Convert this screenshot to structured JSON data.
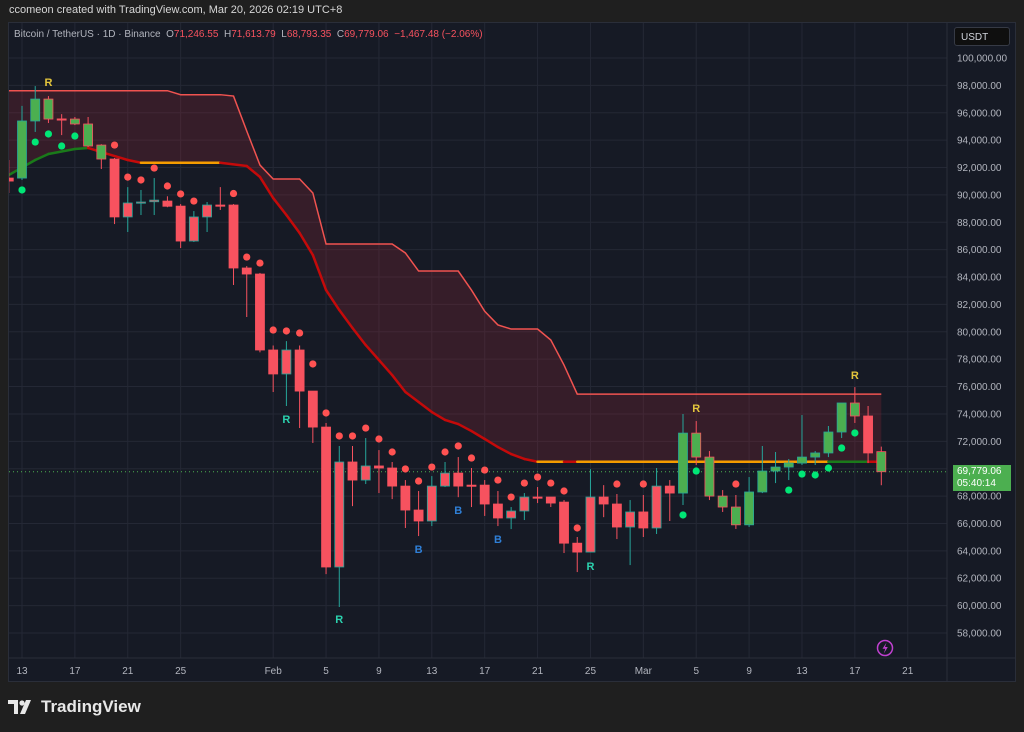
{
  "credit": "ccomeon created with TradingView.com, Mar 20, 2026 02:19 UTC+8",
  "legend": {
    "symbol": "Bitcoin / TetherUS · 1D · Binance",
    "open_label": "O",
    "open": "71,246.55",
    "high_label": "H",
    "high": "71,613.79",
    "low_label": "L",
    "low": "68,793.35",
    "close_label": "C",
    "close": "69,779.06",
    "change": "−1,467.48 (−2.06%)"
  },
  "currency_button": "USDT",
  "last_price": {
    "value": 69779.06,
    "label": "69,779.06",
    "countdown": "05:40:14"
  },
  "brand": "TradingView",
  "icons": {
    "alert": "lightning-icon",
    "logo": "tradingview-logo-icon"
  },
  "colors": {
    "background": "#161a25",
    "grid": "#242835",
    "up_border": "#26a69a",
    "down_border": "#f7525f",
    "fill_green": "#4caf50",
    "fill_red": "#f7525f",
    "dot_green": "#00e676",
    "dot_red": "#ff5252",
    "band": "#f05350",
    "mid_red": "#c40a0a",
    "mid_orange": "#f59c00",
    "mid_green": "#1a7a1a",
    "label_yellow": "#e3c53c",
    "label_teal": "#2bd1ae",
    "label_blue": "#2f7fd6"
  },
  "chart_data": {
    "type": "candlestick",
    "interval": "1D",
    "ylim": [
      56500,
      101500
    ],
    "y_ticks": [
      100000,
      98000,
      96000,
      94000,
      92000,
      90000,
      88000,
      86000,
      84000,
      82000,
      80000,
      78000,
      76000,
      74000,
      72000,
      70000,
      68000,
      66000,
      64000,
      62000,
      60000,
      58000
    ],
    "y_tick_labels": [
      "100,000.00",
      "98,000.00",
      "96,000.00",
      "94,000.00",
      "92,000.00",
      "90,000.00",
      "88,000.00",
      "86,000.00",
      "84,000.00",
      "82,000.00",
      "80,000.00",
      "78,000.00",
      "76,000.00",
      "74,000.00",
      "72,000.00",
      "70,000.00",
      "68,000.00",
      "66,000.00",
      "64,000.00",
      "62,000.00",
      "60,000.00",
      "58,000.00"
    ],
    "x_ticks": [
      {
        "date": "2026-01-13",
        "label": "13"
      },
      {
        "date": "2026-01-17",
        "label": "17"
      },
      {
        "date": "2026-01-21",
        "label": "21"
      },
      {
        "date": "2026-01-25",
        "label": "25"
      },
      {
        "date": "2026-02-01",
        "label": "Feb"
      },
      {
        "date": "2026-02-05",
        "label": "5"
      },
      {
        "date": "2026-02-09",
        "label": "9"
      },
      {
        "date": "2026-02-13",
        "label": "13"
      },
      {
        "date": "2026-02-17",
        "label": "17"
      },
      {
        "date": "2026-02-21",
        "label": "21"
      },
      {
        "date": "2026-02-25",
        "label": "25"
      },
      {
        "date": "2026-03-01",
        "label": "Mar"
      },
      {
        "date": "2026-03-05",
        "label": "5"
      },
      {
        "date": "2026-03-09",
        "label": "9"
      },
      {
        "date": "2026-03-13",
        "label": "13"
      },
      {
        "date": "2026-03-17",
        "label": "17"
      },
      {
        "date": "2026-03-21",
        "label": "21"
      }
    ],
    "candles": [
      [
        "2026-01-12",
        91230,
        92550,
        90140,
        91010,
        "r"
      ],
      [
        "2026-01-13",
        91230,
        96500,
        91090,
        95400,
        "g"
      ],
      [
        "2026-01-14",
        95400,
        97950,
        94600,
        97000,
        "g"
      ],
      [
        "2026-01-15",
        97000,
        97220,
        95250,
        95540,
        "g"
      ],
      [
        "2026-01-16",
        95550,
        95900,
        94370,
        95500,
        "r"
      ],
      [
        "2026-01-17",
        95540,
        95690,
        95100,
        95180,
        "g"
      ],
      [
        "2026-01-18",
        95180,
        95690,
        93500,
        93570,
        "g"
      ],
      [
        "2026-01-19",
        93640,
        93700,
        91890,
        92620,
        "g"
      ],
      [
        "2026-01-20",
        92620,
        92700,
        87870,
        88390,
        "r"
      ],
      [
        "2026-01-21",
        88390,
        90570,
        87290,
        89410,
        "r"
      ],
      [
        "2026-01-22",
        89400,
        90360,
        88530,
        89480,
        "r"
      ],
      [
        "2026-01-23",
        89500,
        91230,
        88530,
        89620,
        "r"
      ],
      [
        "2026-01-24",
        89550,
        89900,
        89100,
        89170,
        "r"
      ],
      [
        "2026-01-25",
        89180,
        89330,
        86120,
        86630,
        "r"
      ],
      [
        "2026-01-26",
        86630,
        88820,
        86560,
        88390,
        "r"
      ],
      [
        "2026-01-27",
        88390,
        89480,
        87290,
        89260,
        "r"
      ],
      [
        "2026-01-28",
        89260,
        90570,
        88900,
        89200,
        "r"
      ],
      [
        "2026-01-29",
        89260,
        89330,
        83420,
        84660,
        "r"
      ],
      [
        "2026-01-30",
        84660,
        84800,
        81080,
        84220,
        "r"
      ],
      [
        "2026-01-31",
        84220,
        84300,
        78500,
        78670,
        "r"
      ],
      [
        "2026-02-01",
        78670,
        79000,
        75600,
        76920,
        "r"
      ],
      [
        "2026-02-02",
        76920,
        79320,
        74580,
        78670,
        "r"
      ],
      [
        "2026-02-03",
        78670,
        79000,
        72970,
        75670,
        "r"
      ],
      [
        "2026-02-04",
        75670,
        75670,
        71880,
        73040,
        "r"
      ],
      [
        "2026-02-05",
        73040,
        73340,
        62300,
        62820,
        "r"
      ],
      [
        "2026-02-06",
        62820,
        71660,
        59900,
        70490,
        "r"
      ],
      [
        "2026-02-07",
        70490,
        71660,
        67270,
        69170,
        "r"
      ],
      [
        "2026-02-08",
        69170,
        72240,
        68880,
        70200,
        "r"
      ],
      [
        "2026-02-09",
        70200,
        71360,
        68220,
        70050,
        "r"
      ],
      [
        "2026-02-10",
        70050,
        70490,
        67780,
        68730,
        "r"
      ],
      [
        "2026-02-11",
        68730,
        69170,
        65670,
        66980,
        "r"
      ],
      [
        "2026-02-12",
        66980,
        68370,
        65080,
        66180,
        "r"
      ],
      [
        "2026-02-13",
        66180,
        69460,
        65810,
        68730,
        "r"
      ],
      [
        "2026-02-14",
        68730,
        70490,
        68660,
        69680,
        "r"
      ],
      [
        "2026-02-15",
        69680,
        70850,
        67920,
        68730,
        "r"
      ],
      [
        "2026-02-16",
        68800,
        70050,
        67200,
        68790,
        "r"
      ],
      [
        "2026-02-17",
        68800,
        69170,
        66550,
        67420,
        "r"
      ],
      [
        "2026-02-18",
        67420,
        68370,
        65810,
        66400,
        "r"
      ],
      [
        "2026-02-19",
        66400,
        67200,
        65590,
        66910,
        "r"
      ],
      [
        "2026-02-20",
        66910,
        68220,
        66250,
        67930,
        "r"
      ],
      [
        "2026-02-21",
        67930,
        68660,
        67490,
        67900,
        "r"
      ],
      [
        "2026-02-22",
        67930,
        67930,
        67200,
        67490,
        "r"
      ],
      [
        "2026-02-23",
        67560,
        67710,
        63840,
        64560,
        "r"
      ],
      [
        "2026-02-24",
        64560,
        65010,
        62450,
        63910,
        "r"
      ],
      [
        "2026-02-25",
        63910,
        69970,
        63910,
        67930,
        "r"
      ],
      [
        "2026-02-26",
        67930,
        68800,
        66460,
        67420,
        "r"
      ],
      [
        "2026-02-27",
        67420,
        68150,
        64860,
        65740,
        "r"
      ],
      [
        "2026-02-28",
        65740,
        67710,
        62960,
        66840,
        "r"
      ],
      [
        "2026-03-01",
        66840,
        68080,
        65010,
        65670,
        "r"
      ],
      [
        "2026-03-02",
        65670,
        70050,
        65230,
        68730,
        "r"
      ],
      [
        "2026-03-03",
        68730,
        69170,
        66180,
        68220,
        "r"
      ],
      [
        "2026-03-04",
        68220,
        74000,
        67350,
        72600,
        "g"
      ],
      [
        "2026-03-05",
        72600,
        73480,
        70270,
        70850,
        "g"
      ],
      [
        "2026-03-06",
        70850,
        71290,
        67710,
        68000,
        "g"
      ],
      [
        "2026-03-07",
        68000,
        68440,
        66840,
        67200,
        "g"
      ],
      [
        "2026-03-08",
        67200,
        68080,
        65600,
        65900,
        "g"
      ],
      [
        "2026-03-09",
        65900,
        69390,
        65740,
        68300,
        "g"
      ],
      [
        "2026-03-10",
        68300,
        71660,
        68220,
        69830,
        "g"
      ],
      [
        "2026-03-11",
        69830,
        71220,
        68950,
        70120,
        "g"
      ],
      [
        "2026-03-12",
        70120,
        70710,
        69170,
        70410,
        "g"
      ],
      [
        "2026-03-13",
        70410,
        73920,
        70270,
        70850,
        "g"
      ],
      [
        "2026-03-14",
        70850,
        71290,
        70270,
        71150,
        "g"
      ],
      [
        "2026-03-15",
        71150,
        73120,
        70850,
        72680,
        "g"
      ],
      [
        "2026-03-16",
        72680,
        74800,
        72240,
        74800,
        "g"
      ],
      [
        "2026-03-17",
        74800,
        75960,
        73340,
        73850,
        "g"
      ],
      [
        "2026-03-18",
        73850,
        74580,
        70410,
        71150,
        "r"
      ],
      [
        "2026-03-19",
        71246.55,
        71613.79,
        68793.35,
        69779.06,
        "g"
      ]
    ],
    "upper_band": [
      [
        "2026-01-12",
        97610
      ],
      [
        "2026-01-24",
        97610
      ],
      [
        "2026-01-25",
        97320
      ],
      [
        "2026-01-28",
        97320
      ],
      [
        "2026-01-29",
        97220
      ],
      [
        "2026-01-30",
        94670
      ],
      [
        "2026-01-31",
        92180
      ],
      [
        "2026-02-01",
        91160
      ],
      [
        "2026-02-03",
        91160
      ],
      [
        "2026-02-04",
        90140
      ],
      [
        "2026-02-05",
        86410
      ],
      [
        "2026-02-10",
        86410
      ],
      [
        "2026-02-11",
        85760
      ],
      [
        "2026-02-12",
        84440
      ],
      [
        "2026-02-15",
        84440
      ],
      [
        "2026-02-16",
        83050
      ],
      [
        "2026-02-17",
        81500
      ],
      [
        "2026-02-18",
        80500
      ],
      [
        "2026-02-19",
        80200
      ],
      [
        "2026-02-21",
        80200
      ],
      [
        "2026-02-22",
        79400
      ],
      [
        "2026-02-23",
        77570
      ],
      [
        "2026-02-24",
        75450
      ],
      [
        "2026-03-19",
        75450
      ]
    ],
    "middle_line": [
      [
        "2026-01-12",
        91450,
        "green"
      ],
      [
        "2026-01-14",
        92550,
        "green"
      ],
      [
        "2026-01-15",
        92990,
        "green"
      ],
      [
        "2026-01-17",
        93350,
        "green"
      ],
      [
        "2026-01-18",
        93430,
        "red"
      ],
      [
        "2026-01-19",
        93130,
        "red"
      ],
      [
        "2026-01-21",
        92550,
        "red"
      ],
      [
        "2026-01-22",
        92350,
        "orange"
      ],
      [
        "2026-01-28",
        92350,
        "red"
      ],
      [
        "2026-01-30",
        92110,
        "red"
      ],
      [
        "2026-01-31",
        91310,
        "red"
      ],
      [
        "2026-02-01",
        89770,
        "red"
      ],
      [
        "2026-02-02",
        88530,
        "red"
      ],
      [
        "2026-02-03",
        87220,
        "red"
      ],
      [
        "2026-02-04",
        85610,
        "red"
      ],
      [
        "2026-02-05",
        83050,
        "red"
      ],
      [
        "2026-02-06",
        81590,
        "red"
      ],
      [
        "2026-02-07",
        80280,
        "red"
      ],
      [
        "2026-02-08",
        79030,
        "red"
      ],
      [
        "2026-02-09",
        77940,
        "red"
      ],
      [
        "2026-02-10",
        76840,
        "red"
      ],
      [
        "2026-02-11",
        75600,
        "red"
      ],
      [
        "2026-02-12",
        74870,
        "red"
      ],
      [
        "2026-02-13",
        74140,
        "red"
      ],
      [
        "2026-02-14",
        73560,
        "red"
      ],
      [
        "2026-02-15",
        73260,
        "red"
      ],
      [
        "2026-02-16",
        72750,
        "red"
      ],
      [
        "2026-02-17",
        72170,
        "red"
      ],
      [
        "2026-02-18",
        71580,
        "red"
      ],
      [
        "2026-02-19",
        71070,
        "red"
      ],
      [
        "2026-02-20",
        70710,
        "red"
      ],
      [
        "2026-02-21",
        70510,
        "orange"
      ],
      [
        "2026-02-23",
        70510,
        "red"
      ],
      [
        "2026-02-24",
        70510,
        "orange"
      ],
      [
        "2026-03-15",
        70510,
        "green"
      ],
      [
        "2026-03-18",
        70510,
        "red"
      ],
      [
        "2026-03-19",
        70510,
        "red"
      ]
    ],
    "dots": [
      [
        "2026-01-13",
        90360,
        "green"
      ],
      [
        "2026-01-14",
        93860,
        "green"
      ],
      [
        "2026-01-15",
        94450,
        "green"
      ],
      [
        "2026-01-16",
        93570,
        "green"
      ],
      [
        "2026-01-17",
        94300,
        "green"
      ],
      [
        "2026-01-20",
        93640,
        "red"
      ],
      [
        "2026-01-21",
        91300,
        "red"
      ],
      [
        "2026-01-22",
        91090,
        "red"
      ],
      [
        "2026-01-23",
        91960,
        "red"
      ],
      [
        "2026-01-24",
        90650,
        "red"
      ],
      [
        "2026-01-25",
        90070,
        "red"
      ],
      [
        "2026-01-26",
        89550,
        "red"
      ],
      [
        "2026-01-29",
        90100,
        "red"
      ],
      [
        "2026-01-30",
        85460,
        "red"
      ],
      [
        "2026-01-31",
        85020,
        "red"
      ],
      [
        "2026-02-01",
        80130,
        "red"
      ],
      [
        "2026-02-02",
        80060,
        "red"
      ],
      [
        "2026-02-03",
        79910,
        "red"
      ],
      [
        "2026-02-04",
        77650,
        "red"
      ],
      [
        "2026-02-05",
        74070,
        "red"
      ],
      [
        "2026-02-06",
        72390,
        "red"
      ],
      [
        "2026-02-07",
        72390,
        "red"
      ],
      [
        "2026-02-08",
        72970,
        "red"
      ],
      [
        "2026-02-09",
        72170,
        "red"
      ],
      [
        "2026-02-10",
        71220,
        "red"
      ],
      [
        "2026-02-11",
        69980,
        "red"
      ],
      [
        "2026-02-12",
        69100,
        "red"
      ],
      [
        "2026-02-13",
        70120,
        "red"
      ],
      [
        "2026-02-14",
        71220,
        "red"
      ],
      [
        "2026-02-15",
        71660,
        "red"
      ],
      [
        "2026-02-16",
        70780,
        "red"
      ],
      [
        "2026-02-17",
        69900,
        "red"
      ],
      [
        "2026-02-18",
        69170,
        "red"
      ],
      [
        "2026-02-19",
        67930,
        "red"
      ],
      [
        "2026-02-20",
        68950,
        "red"
      ],
      [
        "2026-02-21",
        69390,
        "red"
      ],
      [
        "2026-02-22",
        68950,
        "red"
      ],
      [
        "2026-02-23",
        68370,
        "red"
      ],
      [
        "2026-02-24",
        65670,
        "red"
      ],
      [
        "2026-02-27",
        68880,
        "red"
      ],
      [
        "2026-03-01",
        68880,
        "red"
      ],
      [
        "2026-03-04",
        66620,
        "green"
      ],
      [
        "2026-03-05",
        69830,
        "green"
      ],
      [
        "2026-03-08",
        68880,
        "red"
      ],
      [
        "2026-03-12",
        68440,
        "green"
      ],
      [
        "2026-03-13",
        69610,
        "green"
      ],
      [
        "2026-03-14",
        69540,
        "green"
      ],
      [
        "2026-03-15",
        70050,
        "green"
      ],
      [
        "2026-03-16",
        71510,
        "green"
      ],
      [
        "2026-03-17",
        72610,
        "green"
      ]
    ],
    "signal_labels": [
      [
        "2026-01-15",
        98250,
        "R",
        "yellow"
      ],
      [
        "2026-02-02",
        73630,
        "R",
        "teal"
      ],
      [
        "2026-02-06",
        59020,
        "R",
        "teal"
      ],
      [
        "2026-02-12",
        64130,
        "B",
        "blue"
      ],
      [
        "2026-02-15",
        66980,
        "B",
        "blue"
      ],
      [
        "2026-02-18",
        64860,
        "B",
        "blue"
      ],
      [
        "2026-02-25",
        62890,
        "R",
        "teal"
      ],
      [
        "2026-03-05",
        74430,
        "R",
        "yellow"
      ],
      [
        "2026-03-17",
        76840,
        "R",
        "yellow"
      ]
    ]
  }
}
